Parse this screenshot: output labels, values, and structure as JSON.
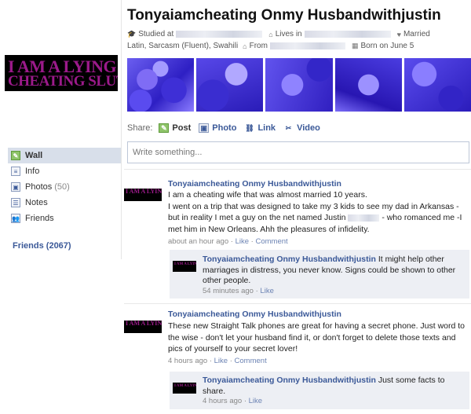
{
  "profile": {
    "name": "Tonyaiamcheating Onmy Husbandwithjustin",
    "studied_label": "Studied at",
    "lives_label": "Lives in",
    "relationship": "Married",
    "languages": "Latin, Sarcasm (Fluent), Swahili",
    "from_label": "From",
    "born": "Born on June 5",
    "picture_line1": "I AM A LYING",
    "picture_line2": "CHEATING SLUT"
  },
  "nav": {
    "items": [
      {
        "label": "Wall",
        "icon": "wall-icon"
      },
      {
        "label": "Info",
        "icon": "info-icon"
      },
      {
        "label": "Photos",
        "count": "(50)",
        "icon": "photos-icon"
      },
      {
        "label": "Notes",
        "icon": "notes-icon"
      },
      {
        "label": "Friends",
        "icon": "friends-icon"
      }
    ],
    "friends_link": "Friends (2067)"
  },
  "share": {
    "label": "Share:",
    "options": [
      "Post",
      "Photo",
      "Link",
      "Video"
    ],
    "composer_placeholder": "Write something..."
  },
  "stories": [
    {
      "author": "Tonyaiamcheating Onmy Husbandwithjustin",
      "text_lines": [
        "I am a cheating wife that was almost married 10 years.",
        "I went on a trip that was designed to take my 3 kids to see my dad in Arkansas -",
        "but in reality I met a guy on the net named Justin",
        " - who romanced me -I",
        "met him in New Orleans. Ahh the pleasures of infidelity."
      ],
      "time": "about an hour ago",
      "like": "Like",
      "comment": "Comment",
      "comments": [
        {
          "author": "Tonyaiamcheating Onmy Husbandwithjustin",
          "text": "It might help other marriages in distress, you never know. Signs could be shown to other other people.",
          "time": "54 minutes ago",
          "like": "Like"
        }
      ]
    },
    {
      "author": "Tonyaiamcheating Onmy Husbandwithjustin",
      "text": "These new Straight Talk phones are great for having a secret phone. Just word to the wise - don't let your husband find it, or don't forget to delete those texts and pics of yourself to your secret lover!",
      "time": "4 hours ago",
      "like": "Like",
      "comment": "Comment",
      "comments": [
        {
          "author": "Tonyaiamcheating Onmy Husbandwithjustin",
          "text": "Just some facts to share.",
          "time": "4 hours ago",
          "like": "Like"
        }
      ]
    }
  ],
  "colors": {
    "link": "#3b5998",
    "nav_active": "#d8dfea",
    "comment_bg": "#edeff4",
    "picture_text": "#9b1a8a"
  }
}
